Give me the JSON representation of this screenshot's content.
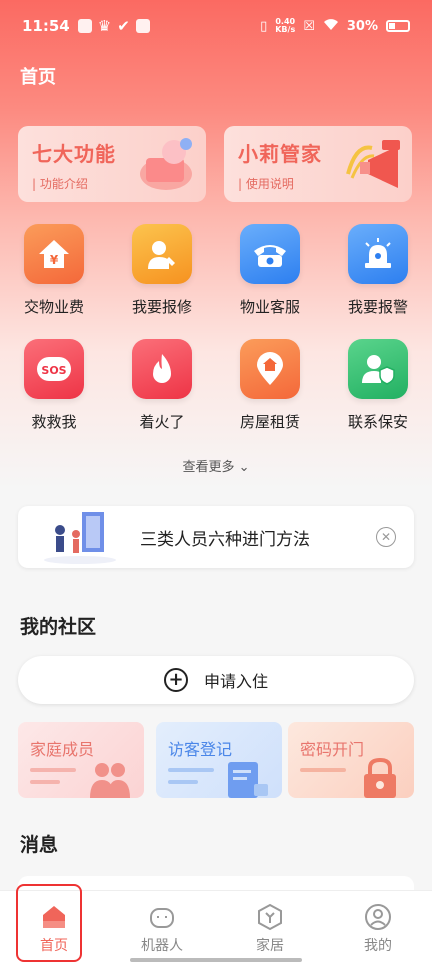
{
  "status_bar": {
    "time": "11:54",
    "speed_top": "0.40",
    "speed_bottom": "KB/s",
    "battery": "30%"
  },
  "header": {
    "title": "首页"
  },
  "feature_cards": [
    {
      "title": "七大功能",
      "subtitle": "| 功能介绍"
    },
    {
      "title": "小莉管家",
      "subtitle": "| 使用说明"
    }
  ],
  "services": [
    {
      "label": "交物业费",
      "icon": "house-yen-icon",
      "color": "#f77a48"
    },
    {
      "label": "我要报修",
      "icon": "repair-icon",
      "color": "#f9a232"
    },
    {
      "label": "物业客服",
      "icon": "phone-icon",
      "color": "#3f8ef5"
    },
    {
      "label": "我要报警",
      "icon": "alarm-icon",
      "color": "#3f8ef5"
    },
    {
      "label": "救救我",
      "icon": "sos-icon",
      "color": "#f24a5a"
    },
    {
      "label": "着火了",
      "icon": "fire-icon",
      "color": "#f24a5a"
    },
    {
      "label": "房屋租赁",
      "icon": "location-house-icon",
      "color": "#f77a48"
    },
    {
      "label": "联系保安",
      "icon": "security-guard-icon",
      "color": "#33c073"
    }
  ],
  "see_more": "查看更多",
  "banner": {
    "text": "三类人员六种进门方法"
  },
  "community": {
    "title": "我的社区",
    "apply_label": "申请入住",
    "cards": [
      {
        "label": "家庭成员",
        "color": "#e8756d",
        "bg": "#fce3e3"
      },
      {
        "label": "访客登记",
        "color": "#4a86e8",
        "bg": "#dfeafc"
      },
      {
        "label": "密码开门",
        "color": "#e8756d",
        "bg": "#fde1d8"
      }
    ]
  },
  "messages": {
    "title": "消息"
  },
  "tabbar": [
    {
      "label": "首页",
      "icon": "home-icon",
      "active": true
    },
    {
      "label": "机器人",
      "icon": "robot-icon",
      "active": false
    },
    {
      "label": "家居",
      "icon": "smart-home-icon",
      "active": false
    },
    {
      "label": "我的",
      "icon": "profile-icon",
      "active": false
    }
  ]
}
